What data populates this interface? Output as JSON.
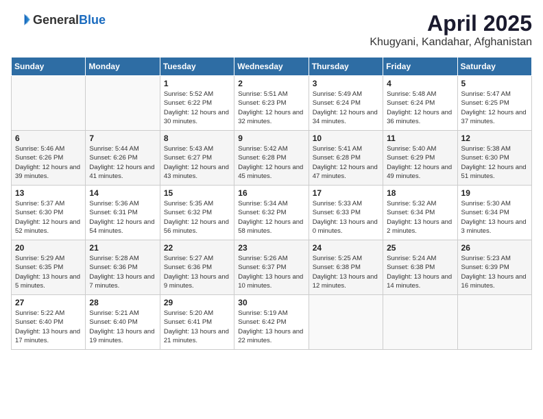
{
  "logo": {
    "general": "General",
    "blue": "Blue"
  },
  "title": "April 2025",
  "location": "Khugyani, Kandahar, Afghanistan",
  "days_of_week": [
    "Sunday",
    "Monday",
    "Tuesday",
    "Wednesday",
    "Thursday",
    "Friday",
    "Saturday"
  ],
  "weeks": [
    [
      {
        "num": "",
        "detail": ""
      },
      {
        "num": "",
        "detail": ""
      },
      {
        "num": "1",
        "detail": "Sunrise: 5:52 AM\nSunset: 6:22 PM\nDaylight: 12 hours\nand 30 minutes."
      },
      {
        "num": "2",
        "detail": "Sunrise: 5:51 AM\nSunset: 6:23 PM\nDaylight: 12 hours\nand 32 minutes."
      },
      {
        "num": "3",
        "detail": "Sunrise: 5:49 AM\nSunset: 6:24 PM\nDaylight: 12 hours\nand 34 minutes."
      },
      {
        "num": "4",
        "detail": "Sunrise: 5:48 AM\nSunset: 6:24 PM\nDaylight: 12 hours\nand 36 minutes."
      },
      {
        "num": "5",
        "detail": "Sunrise: 5:47 AM\nSunset: 6:25 PM\nDaylight: 12 hours\nand 37 minutes."
      }
    ],
    [
      {
        "num": "6",
        "detail": "Sunrise: 5:46 AM\nSunset: 6:26 PM\nDaylight: 12 hours\nand 39 minutes."
      },
      {
        "num": "7",
        "detail": "Sunrise: 5:44 AM\nSunset: 6:26 PM\nDaylight: 12 hours\nand 41 minutes."
      },
      {
        "num": "8",
        "detail": "Sunrise: 5:43 AM\nSunset: 6:27 PM\nDaylight: 12 hours\nand 43 minutes."
      },
      {
        "num": "9",
        "detail": "Sunrise: 5:42 AM\nSunset: 6:28 PM\nDaylight: 12 hours\nand 45 minutes."
      },
      {
        "num": "10",
        "detail": "Sunrise: 5:41 AM\nSunset: 6:28 PM\nDaylight: 12 hours\nand 47 minutes."
      },
      {
        "num": "11",
        "detail": "Sunrise: 5:40 AM\nSunset: 6:29 PM\nDaylight: 12 hours\nand 49 minutes."
      },
      {
        "num": "12",
        "detail": "Sunrise: 5:38 AM\nSunset: 6:30 PM\nDaylight: 12 hours\nand 51 minutes."
      }
    ],
    [
      {
        "num": "13",
        "detail": "Sunrise: 5:37 AM\nSunset: 6:30 PM\nDaylight: 12 hours\nand 52 minutes."
      },
      {
        "num": "14",
        "detail": "Sunrise: 5:36 AM\nSunset: 6:31 PM\nDaylight: 12 hours\nand 54 minutes."
      },
      {
        "num": "15",
        "detail": "Sunrise: 5:35 AM\nSunset: 6:32 PM\nDaylight: 12 hours\nand 56 minutes."
      },
      {
        "num": "16",
        "detail": "Sunrise: 5:34 AM\nSunset: 6:32 PM\nDaylight: 12 hours\nand 58 minutes."
      },
      {
        "num": "17",
        "detail": "Sunrise: 5:33 AM\nSunset: 6:33 PM\nDaylight: 13 hours\nand 0 minutes."
      },
      {
        "num": "18",
        "detail": "Sunrise: 5:32 AM\nSunset: 6:34 PM\nDaylight: 13 hours\nand 2 minutes."
      },
      {
        "num": "19",
        "detail": "Sunrise: 5:30 AM\nSunset: 6:34 PM\nDaylight: 13 hours\nand 3 minutes."
      }
    ],
    [
      {
        "num": "20",
        "detail": "Sunrise: 5:29 AM\nSunset: 6:35 PM\nDaylight: 13 hours\nand 5 minutes."
      },
      {
        "num": "21",
        "detail": "Sunrise: 5:28 AM\nSunset: 6:36 PM\nDaylight: 13 hours\nand 7 minutes."
      },
      {
        "num": "22",
        "detail": "Sunrise: 5:27 AM\nSunset: 6:36 PM\nDaylight: 13 hours\nand 9 minutes."
      },
      {
        "num": "23",
        "detail": "Sunrise: 5:26 AM\nSunset: 6:37 PM\nDaylight: 13 hours\nand 10 minutes."
      },
      {
        "num": "24",
        "detail": "Sunrise: 5:25 AM\nSunset: 6:38 PM\nDaylight: 13 hours\nand 12 minutes."
      },
      {
        "num": "25",
        "detail": "Sunrise: 5:24 AM\nSunset: 6:38 PM\nDaylight: 13 hours\nand 14 minutes."
      },
      {
        "num": "26",
        "detail": "Sunrise: 5:23 AM\nSunset: 6:39 PM\nDaylight: 13 hours\nand 16 minutes."
      }
    ],
    [
      {
        "num": "27",
        "detail": "Sunrise: 5:22 AM\nSunset: 6:40 PM\nDaylight: 13 hours\nand 17 minutes."
      },
      {
        "num": "28",
        "detail": "Sunrise: 5:21 AM\nSunset: 6:40 PM\nDaylight: 13 hours\nand 19 minutes."
      },
      {
        "num": "29",
        "detail": "Sunrise: 5:20 AM\nSunset: 6:41 PM\nDaylight: 13 hours\nand 21 minutes."
      },
      {
        "num": "30",
        "detail": "Sunrise: 5:19 AM\nSunset: 6:42 PM\nDaylight: 13 hours\nand 22 minutes."
      },
      {
        "num": "",
        "detail": ""
      },
      {
        "num": "",
        "detail": ""
      },
      {
        "num": "",
        "detail": ""
      }
    ]
  ]
}
